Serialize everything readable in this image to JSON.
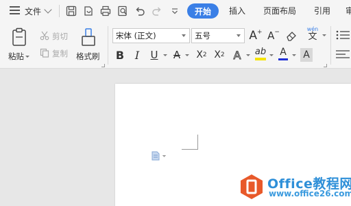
{
  "menubar": {
    "file_label": "文件",
    "tabs": [
      {
        "label": "开始",
        "active": true
      },
      {
        "label": "插入"
      },
      {
        "label": "页面布局"
      },
      {
        "label": "引用"
      },
      {
        "label": "审"
      }
    ]
  },
  "ribbon": {
    "paste_label": "粘贴",
    "cut_label": "剪切",
    "copy_label": "复制",
    "format_painter_label": "格式刷",
    "font_family": "宋体 (正文)",
    "font_size": "五号",
    "grow_font": "A",
    "shrink_font": "A",
    "phonetic_label": "wén",
    "phonetic_char": "文",
    "bold": "B",
    "italic": "I",
    "underline": "U",
    "strikethrough": "A",
    "superscript_base": "X",
    "superscript_exp": "2",
    "subscript_base": "X",
    "subscript_exp": "2",
    "text_effect": "A",
    "highlight": "ab",
    "font_color": "A",
    "char_shading": "A"
  },
  "colors": {
    "accent": "#3a7fe6",
    "highlight_bar": "#f5e400",
    "font_color_bar": "#1f2fd6",
    "watermark_orange": "#e8592a",
    "watermark_blue": "#2e8fd8"
  },
  "watermark": {
    "title": "Office教程网",
    "url": "www.office26.com"
  }
}
